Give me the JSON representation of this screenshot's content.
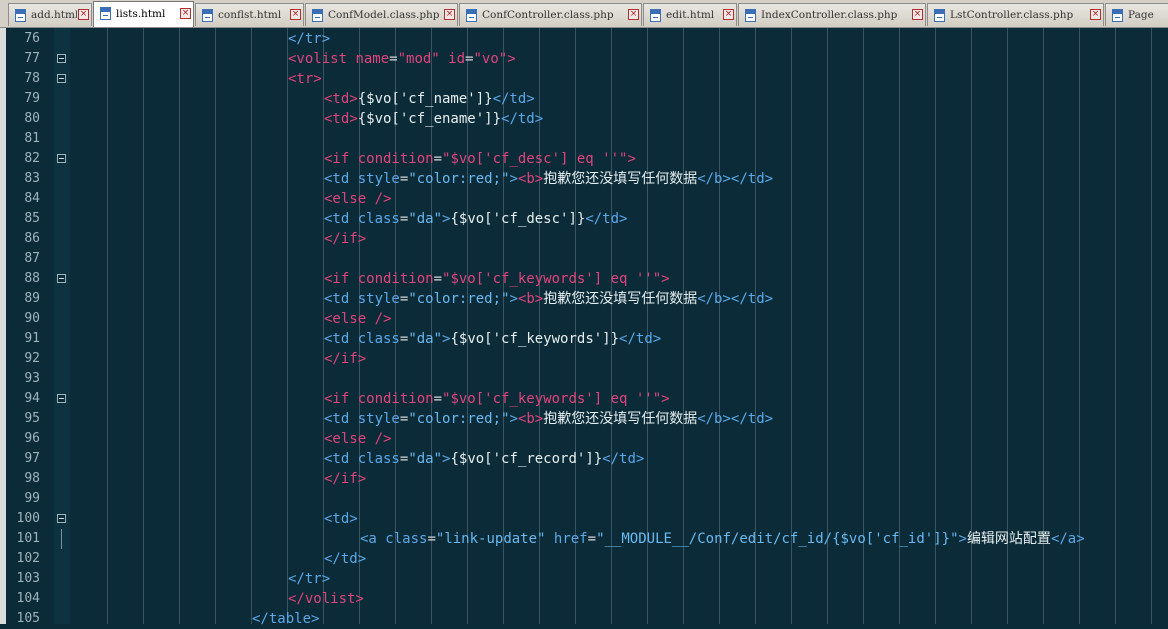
{
  "tabs": [
    {
      "label": "add.html"
    },
    {
      "label": "lists.html",
      "active": true
    },
    {
      "label": "conflst.html"
    },
    {
      "label": "ConfModel.class.php"
    },
    {
      "label": "ConfController.class.php"
    },
    {
      "label": "edit.html"
    },
    {
      "label": "IndexController.class.php"
    },
    {
      "label": "LstController.class.php"
    },
    {
      "label": "Page"
    }
  ],
  "tab_close_glyph": "×",
  "colors": {
    "editor_background": "#0b2b38",
    "tag_keyword": "#e0447c",
    "tag_blue": "#5aa8e8",
    "plain_text": "#e6eef0"
  },
  "lines": [
    {
      "n": "76",
      "indent": 8,
      "tokens": [
        [
          "</tr>",
          "t-tag2"
        ]
      ]
    },
    {
      "n": "77",
      "indent": 8,
      "fold": true,
      "tokens": [
        [
          "<volist ",
          "t-tag"
        ],
        [
          "name",
          "t-attr"
        ],
        [
          "=",
          "t-eq"
        ],
        [
          "\"mod\"",
          "t-str"
        ],
        [
          " id",
          "t-attr"
        ],
        [
          "=",
          "t-eq"
        ],
        [
          "\"vo\"",
          "t-str"
        ],
        [
          ">",
          "t-tag"
        ]
      ]
    },
    {
      "n": "78",
      "indent": 8,
      "fold": true,
      "tokens": [
        [
          "<tr>",
          "t-tag"
        ]
      ]
    },
    {
      "n": "79",
      "indent": 9,
      "tokens": [
        [
          "<td>",
          "t-tag"
        ],
        [
          "{$vo['cf_name']}",
          "t-txt"
        ],
        [
          "</td>",
          "t-tag2"
        ]
      ]
    },
    {
      "n": "80",
      "indent": 9,
      "tokens": [
        [
          "<td>",
          "t-tag"
        ],
        [
          "{$vo['cf_ename']}",
          "t-txt"
        ],
        [
          "</td>",
          "t-tag2"
        ]
      ]
    },
    {
      "n": "81",
      "indent": 9,
      "tokens": []
    },
    {
      "n": "82",
      "indent": 9,
      "fold": true,
      "tokens": [
        [
          "<if ",
          "t-tag"
        ],
        [
          "condition",
          "t-attr"
        ],
        [
          "=",
          "t-eq"
        ],
        [
          "\"$vo['cf_desc'] eq ''\"",
          "t-str"
        ],
        [
          ">",
          "t-tag"
        ]
      ]
    },
    {
      "n": "83",
      "indent": 9,
      "tokens": [
        [
          "<td ",
          "t-tag2"
        ],
        [
          "style",
          "t-attr2"
        ],
        [
          "=",
          "t-eq"
        ],
        [
          "\"color:red;\"",
          "t-str2"
        ],
        [
          ">",
          "t-tag2"
        ],
        [
          "<b>",
          "t-tag"
        ],
        [
          "抱歉您还没填写任何数据",
          "t-txt cjk"
        ],
        [
          "</b>",
          "t-tag2"
        ],
        [
          "</td>",
          "t-tag2"
        ]
      ]
    },
    {
      "n": "84",
      "indent": 9,
      "tokens": [
        [
          "<else />",
          "t-tag"
        ]
      ]
    },
    {
      "n": "85",
      "indent": 9,
      "tokens": [
        [
          "<td ",
          "t-tag2"
        ],
        [
          "class",
          "t-attr2"
        ],
        [
          "=",
          "t-eq"
        ],
        [
          "\"da\"",
          "t-str2"
        ],
        [
          ">",
          "t-tag2"
        ],
        [
          "{$vo['cf_desc']}",
          "t-txt"
        ],
        [
          "</td>",
          "t-tag2"
        ]
      ]
    },
    {
      "n": "86",
      "indent": 9,
      "tokens": [
        [
          "</if>",
          "t-tag"
        ]
      ]
    },
    {
      "n": "87",
      "indent": 9,
      "tokens": []
    },
    {
      "n": "88",
      "indent": 9,
      "fold": true,
      "tokens": [
        [
          "<if ",
          "t-tag"
        ],
        [
          "condition",
          "t-attr"
        ],
        [
          "=",
          "t-eq"
        ],
        [
          "\"$vo['cf_keywords'] eq ''\"",
          "t-str"
        ],
        [
          ">",
          "t-tag"
        ]
      ]
    },
    {
      "n": "89",
      "indent": 9,
      "tokens": [
        [
          "<td ",
          "t-tag2"
        ],
        [
          "style",
          "t-attr2"
        ],
        [
          "=",
          "t-eq"
        ],
        [
          "\"color:red;\"",
          "t-str2"
        ],
        [
          ">",
          "t-tag2"
        ],
        [
          "<b>",
          "t-tag"
        ],
        [
          "抱歉您还没填写任何数据",
          "t-txt cjk"
        ],
        [
          "</b>",
          "t-tag2"
        ],
        [
          "</td>",
          "t-tag2"
        ]
      ]
    },
    {
      "n": "90",
      "indent": 9,
      "tokens": [
        [
          "<else />",
          "t-tag"
        ]
      ]
    },
    {
      "n": "91",
      "indent": 9,
      "tokens": [
        [
          "<td ",
          "t-tag2"
        ],
        [
          "class",
          "t-attr2"
        ],
        [
          "=",
          "t-eq"
        ],
        [
          "\"da\"",
          "t-str2"
        ],
        [
          ">",
          "t-tag2"
        ],
        [
          "{$vo['cf_keywords']}",
          "t-txt"
        ],
        [
          "</td>",
          "t-tag2"
        ]
      ]
    },
    {
      "n": "92",
      "indent": 9,
      "tokens": [
        [
          "</if>",
          "t-tag"
        ]
      ]
    },
    {
      "n": "93",
      "indent": 9,
      "tokens": []
    },
    {
      "n": "94",
      "indent": 9,
      "fold": true,
      "tokens": [
        [
          "<if ",
          "t-tag"
        ],
        [
          "condition",
          "t-attr"
        ],
        [
          "=",
          "t-eq"
        ],
        [
          "\"$vo['cf_keywords'] eq ''\"",
          "t-str"
        ],
        [
          ">",
          "t-tag"
        ]
      ]
    },
    {
      "n": "95",
      "indent": 9,
      "tokens": [
        [
          "<td ",
          "t-tag2"
        ],
        [
          "style",
          "t-attr2"
        ],
        [
          "=",
          "t-eq"
        ],
        [
          "\"color:red;\"",
          "t-str2"
        ],
        [
          ">",
          "t-tag2"
        ],
        [
          "<b>",
          "t-tag"
        ],
        [
          "抱歉您还没填写任何数据",
          "t-txt cjk"
        ],
        [
          "</b>",
          "t-tag2"
        ],
        [
          "</td>",
          "t-tag2"
        ]
      ]
    },
    {
      "n": "96",
      "indent": 9,
      "tokens": [
        [
          "<else />",
          "t-tag"
        ]
      ]
    },
    {
      "n": "97",
      "indent": 9,
      "tokens": [
        [
          "<td ",
          "t-tag2"
        ],
        [
          "class",
          "t-attr2"
        ],
        [
          "=",
          "t-eq"
        ],
        [
          "\"da\"",
          "t-str2"
        ],
        [
          ">",
          "t-tag2"
        ],
        [
          "{$vo['cf_record']}",
          "t-txt"
        ],
        [
          "</td>",
          "t-tag2"
        ]
      ]
    },
    {
      "n": "98",
      "indent": 9,
      "tokens": [
        [
          "</if>",
          "t-tag"
        ]
      ]
    },
    {
      "n": "99",
      "indent": 9,
      "tokens": []
    },
    {
      "n": "100",
      "indent": 9,
      "fold": true,
      "tokens": [
        [
          "<td>",
          "t-tag2"
        ]
      ]
    },
    {
      "n": "101",
      "indent": 10,
      "foldline": true,
      "tokens": [
        [
          "<a ",
          "t-tag2"
        ],
        [
          "class",
          "t-attr2"
        ],
        [
          "=",
          "t-eq"
        ],
        [
          "\"link-update\"",
          "t-str2"
        ],
        [
          " href",
          "t-attr2"
        ],
        [
          "=",
          "t-eq"
        ],
        [
          "\"__MODULE__/Conf/edit/cf_id/{$vo['cf_id']}\"",
          "t-str2"
        ],
        [
          ">",
          "t-tag2"
        ],
        [
          "编辑网站配置",
          "t-txt cjk"
        ],
        [
          "</a>",
          "t-tag2"
        ]
      ]
    },
    {
      "n": "102",
      "indent": 9,
      "tokens": [
        [
          "</td>",
          "t-tag2"
        ]
      ]
    },
    {
      "n": "103",
      "indent": 8,
      "tokens": [
        [
          "</tr>",
          "t-tag2"
        ]
      ]
    },
    {
      "n": "104",
      "indent": 8,
      "tokens": [
        [
          "</volist>",
          "t-tag"
        ]
      ]
    },
    {
      "n": "105",
      "indent": 7,
      "tokens": [
        [
          "</table>",
          "t-tag2"
        ]
      ]
    }
  ]
}
